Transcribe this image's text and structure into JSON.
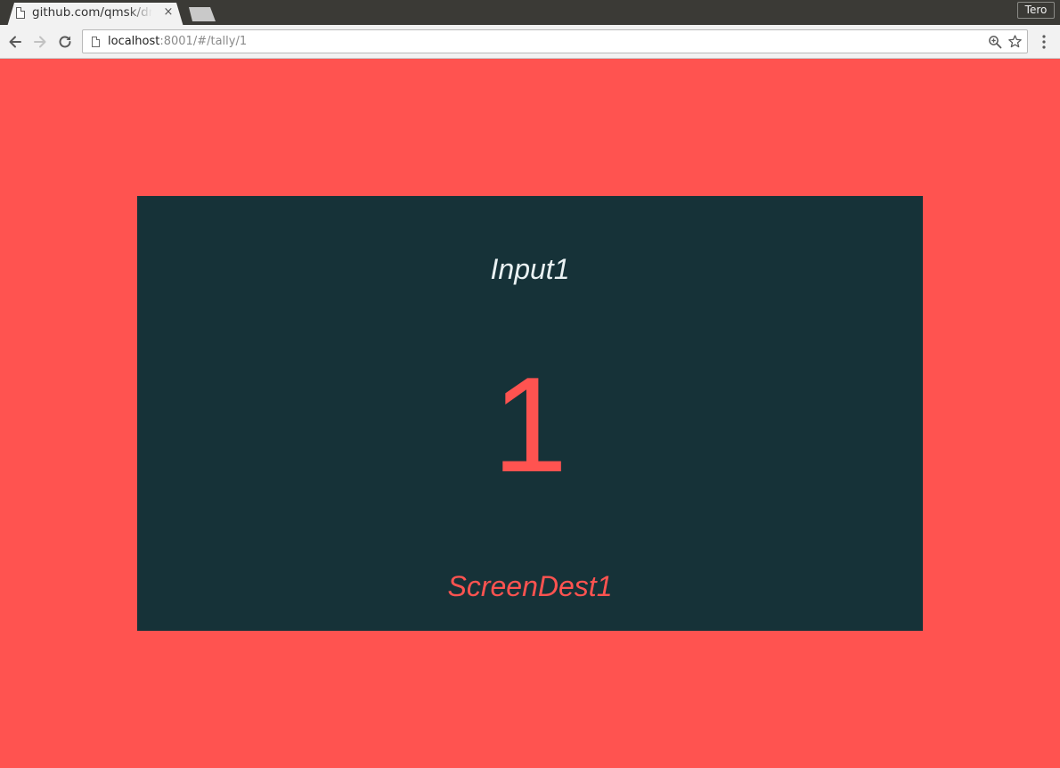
{
  "browser": {
    "tab": {
      "title": "github.com/qmsk/dmx",
      "close_glyph": "×",
      "icon": "page-icon"
    },
    "profile_name": "Tero",
    "address_bar": {
      "host": "localhost",
      "rest": ":8001/#/tally/1"
    },
    "icons": {
      "back": "back-arrow-icon",
      "forward": "forward-arrow-icon",
      "reload": "reload-icon",
      "zoom": "zoom-icon",
      "bookmark": "star-icon",
      "menu": "kebab-menu-icon"
    }
  },
  "tally": {
    "input_name": "Input1",
    "tally_id": "1",
    "destination": "ScreenDest1",
    "colors": {
      "background": "#ff5350",
      "panel": "#163238",
      "input_text": "#eaf2f3",
      "accent": "#ff5350"
    }
  }
}
